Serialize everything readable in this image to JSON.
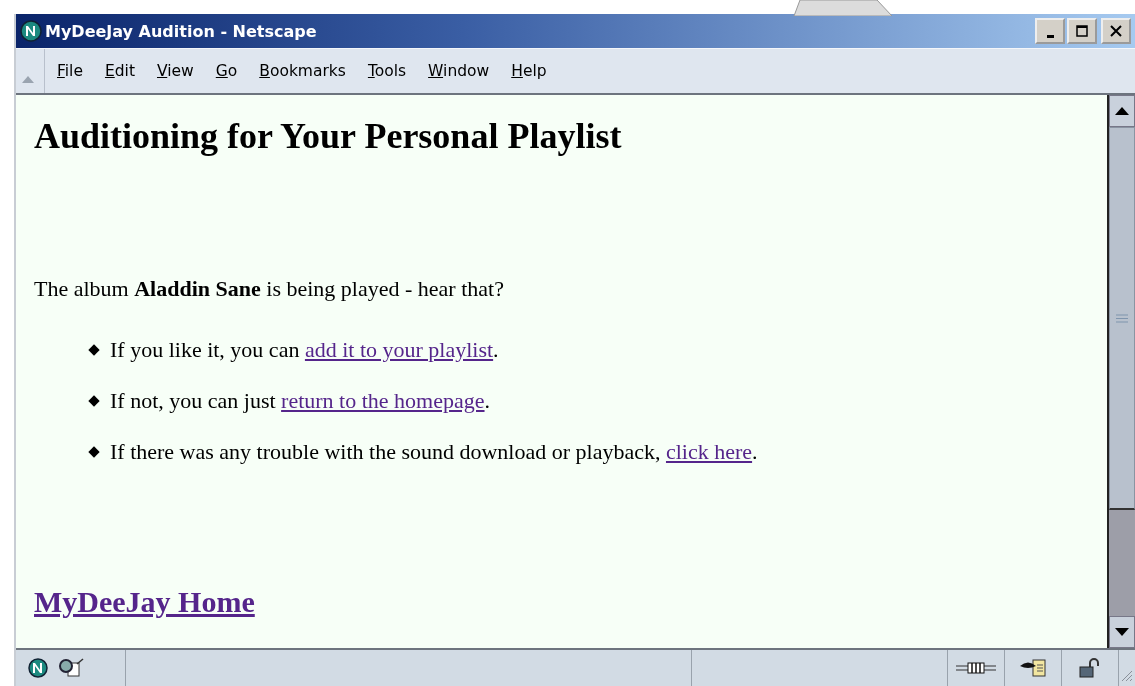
{
  "window": {
    "title": "MyDeeJay Audition - Netscape"
  },
  "menu": [
    {
      "label": "File"
    },
    {
      "label": "Edit"
    },
    {
      "label": "View"
    },
    {
      "label": "Go"
    },
    {
      "label": "Bookmarks"
    },
    {
      "label": "Tools"
    },
    {
      "label": "Window"
    },
    {
      "label": "Help"
    }
  ],
  "page": {
    "heading": "Auditioning for Your Personal Playlist",
    "intro": "The album **Aladdin Sane** is being played - hear that?",
    "bullets": [
      {
        "before": "If you like it, you can ",
        "link": "add it to your playlist",
        "after": "."
      },
      {
        "before": "If not, you can just ",
        "link": "return to the homepage",
        "after": "."
      },
      {
        "before": "If there was any trouble with the sound download or playback, ",
        "link": "click here",
        "after": "."
      }
    ],
    "home_link": "MyDeeJay Home"
  }
}
